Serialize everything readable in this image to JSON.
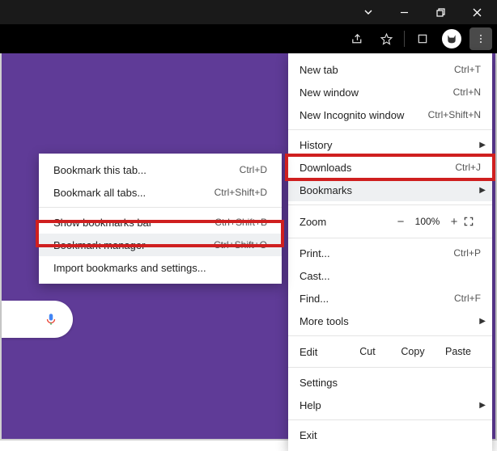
{
  "titlebar": {
    "min": "–",
    "max": "❐",
    "close": "✕"
  },
  "menu": {
    "new_tab": "New tab",
    "new_tab_k": "Ctrl+T",
    "new_window": "New window",
    "new_window_k": "Ctrl+N",
    "incognito": "New Incognito window",
    "incognito_k": "Ctrl+Shift+N",
    "history": "History",
    "downloads": "Downloads",
    "downloads_k": "Ctrl+J",
    "bookmarks": "Bookmarks",
    "zoom": "Zoom",
    "zoom_minus": "−",
    "zoom_val": "100%",
    "zoom_plus": "+",
    "print": "Print...",
    "print_k": "Ctrl+P",
    "cast": "Cast...",
    "find": "Find...",
    "find_k": "Ctrl+F",
    "more_tools": "More tools",
    "edit": "Edit",
    "cut": "Cut",
    "copy": "Copy",
    "paste": "Paste",
    "settings": "Settings",
    "help": "Help",
    "exit": "Exit"
  },
  "submenu": {
    "bookmark_tab": "Bookmark this tab...",
    "bookmark_tab_k": "Ctrl+D",
    "bookmark_all": "Bookmark all tabs...",
    "bookmark_all_k": "Ctrl+Shift+D",
    "show_bar": "Show bookmarks bar",
    "show_bar_k": "Ctrl+Shift+B",
    "manager": "Bookmark manager",
    "manager_k": "Ctrl+Shift+O",
    "import": "Import bookmarks and settings..."
  }
}
